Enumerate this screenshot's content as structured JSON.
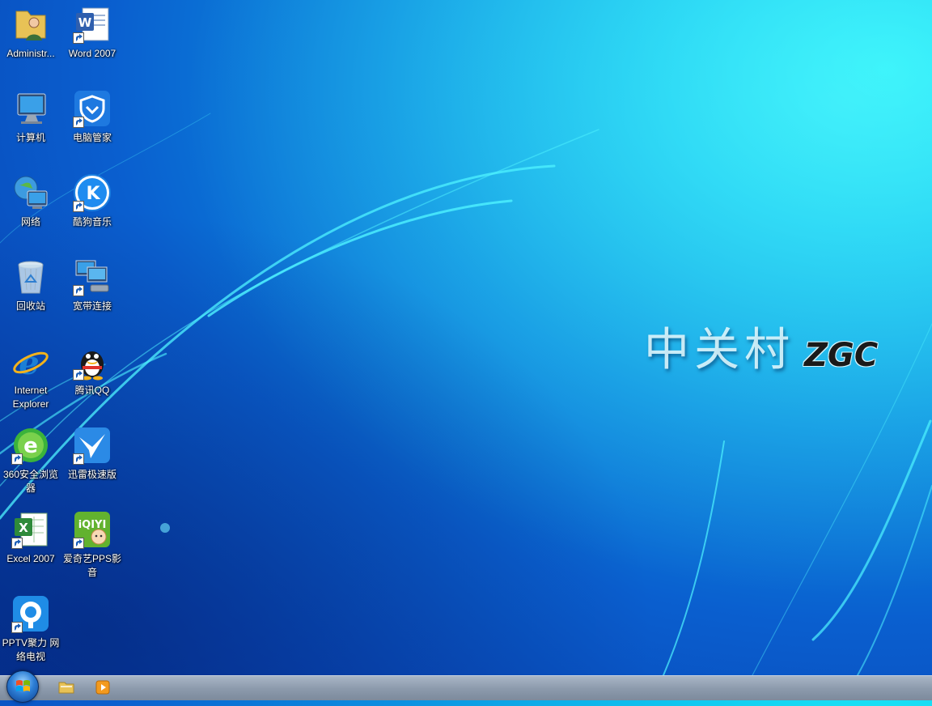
{
  "desktop": {
    "icons": [
      {
        "label": "Administr...",
        "icon": "user-folder-icon",
        "shortcut": false
      },
      {
        "label": "Word 2007",
        "icon": "word-icon",
        "shortcut": true
      },
      {
        "label": "计算机",
        "icon": "computer-icon",
        "shortcut": false
      },
      {
        "label": "电脑管家",
        "icon": "pc-manager-icon",
        "shortcut": true
      },
      {
        "label": "网络",
        "icon": "network-icon",
        "shortcut": false
      },
      {
        "label": "酷狗音乐",
        "icon": "kugou-icon",
        "shortcut": true
      },
      {
        "label": "回收站",
        "icon": "recycle-bin-icon",
        "shortcut": false
      },
      {
        "label": "宽带连接",
        "icon": "broadband-icon",
        "shortcut": true
      },
      {
        "label": "Internet Explorer",
        "icon": "internet-explorer-icon",
        "shortcut": false
      },
      {
        "label": "腾讯QQ",
        "icon": "qq-icon",
        "shortcut": true
      },
      {
        "label": "360安全浏览器",
        "icon": "browser-360-icon",
        "shortcut": true
      },
      {
        "label": "迅雷极速版",
        "icon": "xunlei-icon",
        "shortcut": true
      },
      {
        "label": "Excel 2007",
        "icon": "excel-icon",
        "shortcut": true
      },
      {
        "label": "爱奇艺PPS影音",
        "icon": "iqiyi-icon",
        "shortcut": true
      },
      {
        "label": "PPTV聚力 网络电视",
        "icon": "pptv-icon",
        "shortcut": true
      }
    ]
  },
  "wallpaper": {
    "brand_cn": "中关村",
    "brand_en": "ZGC"
  },
  "taskbar": {
    "start_icon": "windows-start-orb-icon",
    "pinned": [
      {
        "name": "explorer",
        "icon": "folder-icon"
      },
      {
        "name": "media-player",
        "icon": "media-player-icon"
      }
    ]
  }
}
